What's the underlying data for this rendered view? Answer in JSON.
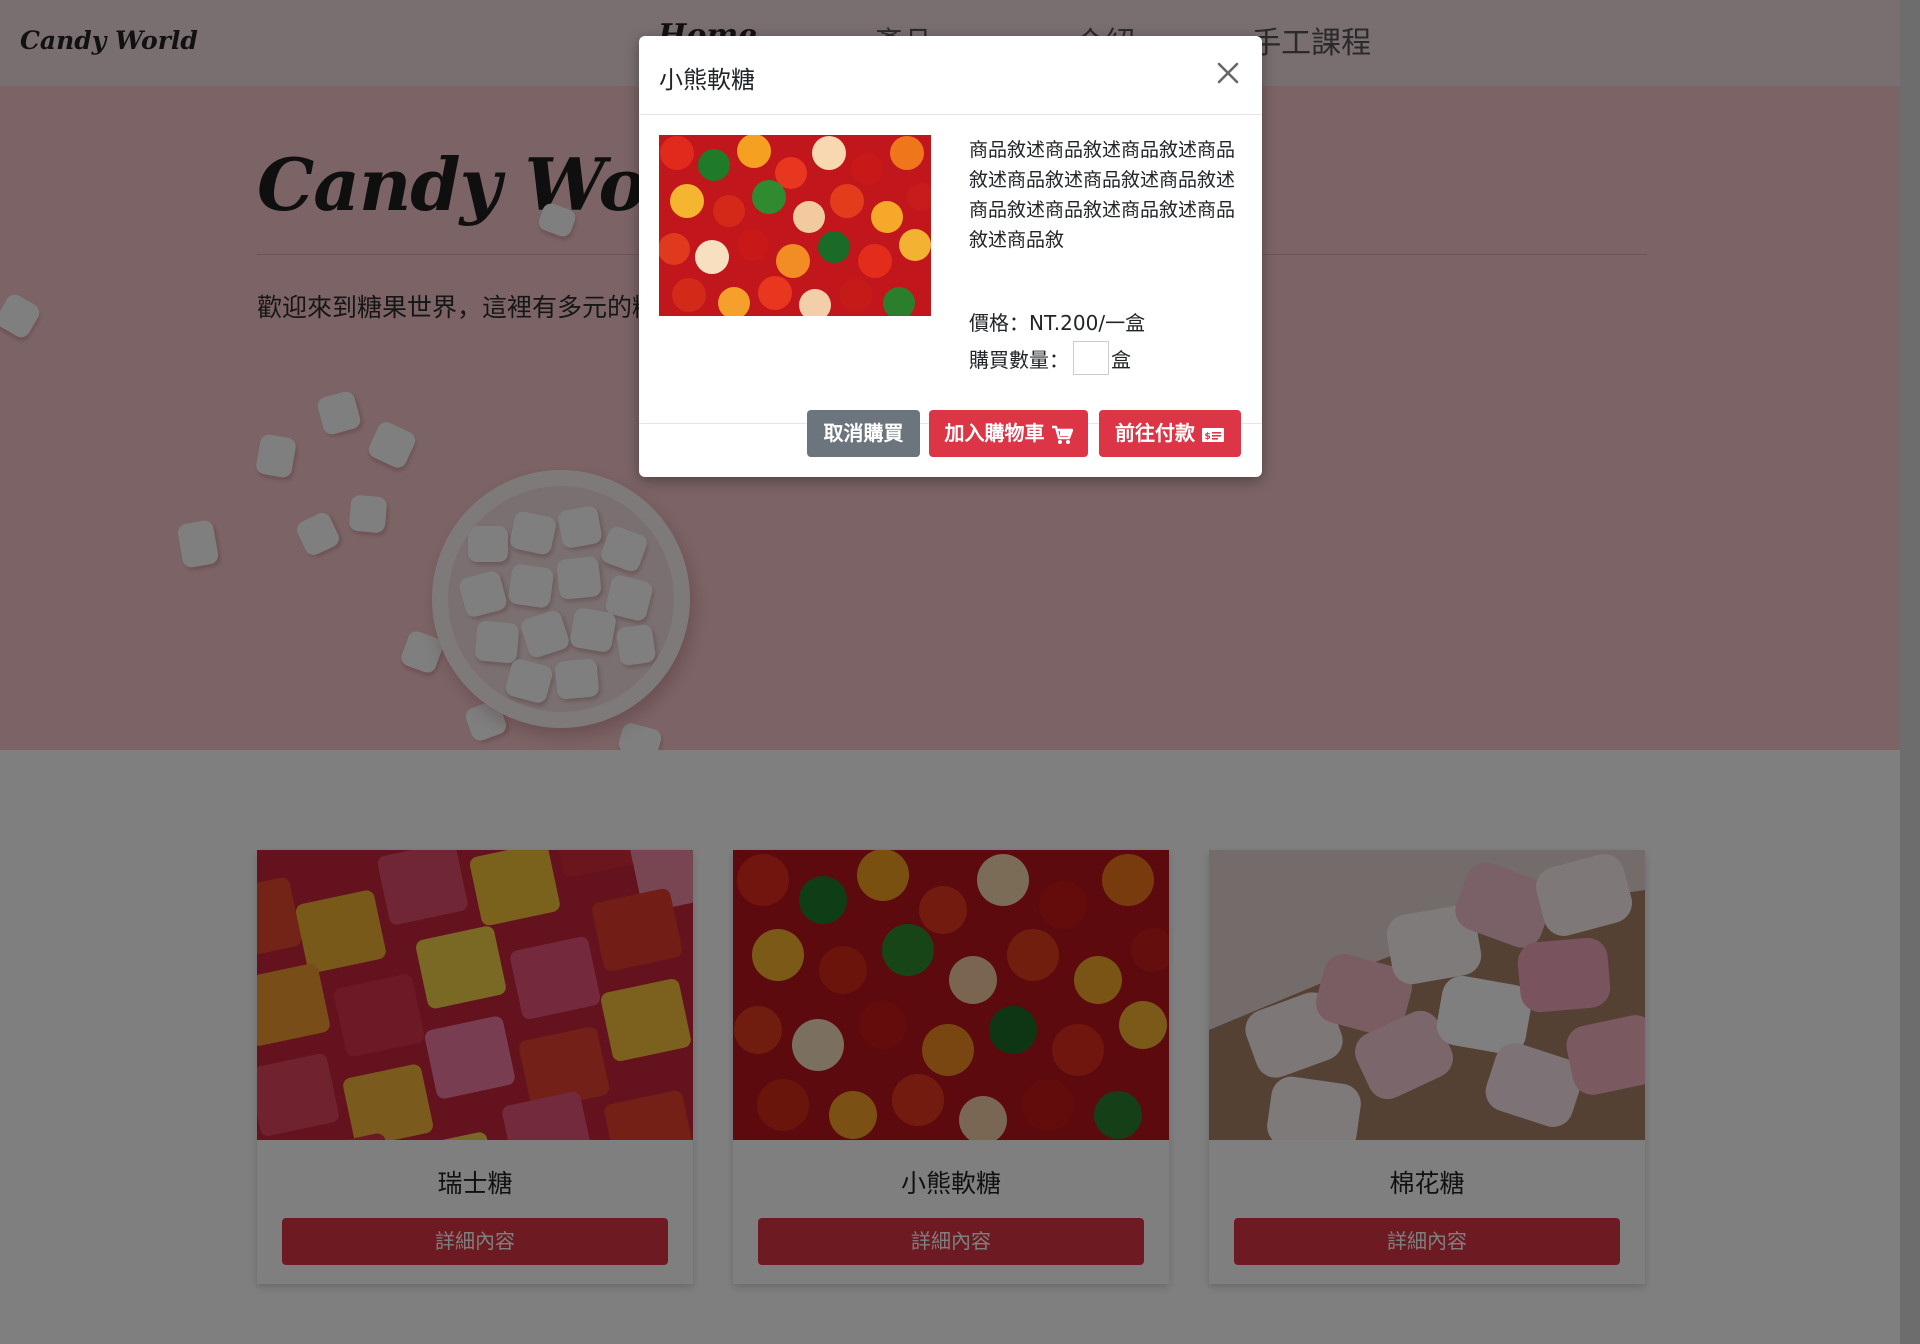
{
  "navbar": {
    "brand": "Candy World",
    "links": [
      "Home",
      "產品",
      "介紹",
      "手工課程"
    ]
  },
  "hero": {
    "title": "Candy World",
    "text": "歡迎來到糖果世界，這裡有多元的糖"
  },
  "products": [
    {
      "name": "瑞士糖",
      "button": "詳細內容"
    },
    {
      "name": "小熊軟糖",
      "button": "詳細內容"
    },
    {
      "name": "棉花糖",
      "button": "詳細內容"
    }
  ],
  "modal": {
    "title": "小熊軟糖",
    "description": "商品敘述商品敘述商品敘述商品敘述商品敘述商品敘述商品敘述商品敘述商品敘述商品敘述商品敘述商品敘",
    "price": "價格：NT.200/一盒",
    "quantity_label": "購買數量：",
    "quantity_value": "",
    "quantity_unit": "盒",
    "cancel_label": "取消購買",
    "add_cart_label": "加入購物車",
    "checkout_label": "前往付款"
  },
  "colors": {
    "accent": "#dc3545",
    "secondary": "#6c757d",
    "hero_bg": "#f9c9cc"
  }
}
